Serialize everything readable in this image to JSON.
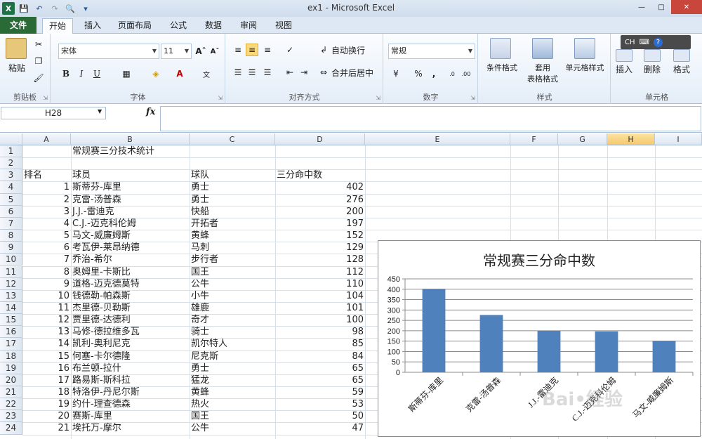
{
  "window": {
    "title": "ex1 - Microsoft Excel"
  },
  "tabs": [
    {
      "label": "文件"
    },
    {
      "label": "开始"
    },
    {
      "label": "插入"
    },
    {
      "label": "页面布局"
    },
    {
      "label": "公式"
    },
    {
      "label": "数据"
    },
    {
      "label": "审阅"
    },
    {
      "label": "视图"
    }
  ],
  "ribbon": {
    "clipboard": {
      "label": "剪贴板",
      "paste": "粘贴"
    },
    "font": {
      "label": "字体",
      "name": "宋体",
      "size": "11",
      "bold": "B",
      "italic": "I",
      "underline": "U"
    },
    "alignment": {
      "label": "对齐方式",
      "wrap": "自动换行",
      "merge": "合并后居中"
    },
    "number": {
      "label": "数字",
      "format": "常规",
      "percent": "%",
      "comma": ","
    },
    "styles": {
      "label": "样式",
      "conditional": "条件格式",
      "table_line1": "套用",
      "table_line2": "表格格式",
      "cell_styles": "单元格样式"
    },
    "cells": {
      "label": "单元格",
      "insert": "插入",
      "delete": "删除",
      "format": "格式"
    }
  },
  "ime": {
    "label": "CH"
  },
  "formula_bar": {
    "name_box": "H28",
    "fx": "fx",
    "value": ""
  },
  "columns": [
    {
      "label": "A"
    },
    {
      "label": "B"
    },
    {
      "label": "C"
    },
    {
      "label": "D"
    },
    {
      "label": "E"
    },
    {
      "label": "F"
    },
    {
      "label": "G"
    },
    {
      "label": "H"
    },
    {
      "label": "I"
    }
  ],
  "row_numbers": [
    "1",
    "2",
    "3",
    "4",
    "5",
    "6",
    "7",
    "8",
    "9",
    "10",
    "11",
    "12",
    "13",
    "14",
    "15",
    "16",
    "17",
    "18",
    "19",
    "20",
    "21",
    "22",
    "23",
    "24"
  ],
  "sheet": {
    "title": "常规赛三分技术统计",
    "headers": {
      "rank": "排名",
      "player": "球员",
      "team": "球队",
      "threes": "三分命中数"
    },
    "rows": [
      {
        "rank": "1",
        "player": "斯蒂芬-库里",
        "team": "勇士",
        "threes": "402"
      },
      {
        "rank": "2",
        "player": "克雷-汤普森",
        "team": "勇士",
        "threes": "276"
      },
      {
        "rank": "3",
        "player": "J.J.-雷迪克",
        "team": "快船",
        "threes": "200"
      },
      {
        "rank": "4",
        "player": "C.J.-迈克科伦姆",
        "team": "开拓者",
        "threes": "197"
      },
      {
        "rank": "5",
        "player": "马文-威廉姆斯",
        "team": "黄蜂",
        "threes": "152"
      },
      {
        "rank": "6",
        "player": "考瓦伊-莱昂纳德",
        "team": "马刺",
        "threes": "129"
      },
      {
        "rank": "7",
        "player": "乔治-希尔",
        "team": "步行者",
        "threes": "128"
      },
      {
        "rank": "8",
        "player": "奥姆里-卡斯比",
        "team": "国王",
        "threes": "112"
      },
      {
        "rank": "9",
        "player": "道格-迈克德莫特",
        "team": "公牛",
        "threes": "110"
      },
      {
        "rank": "10",
        "player": "钱德勒-帕森斯",
        "team": "小牛",
        "threes": "104"
      },
      {
        "rank": "11",
        "player": "杰里德-贝勒斯",
        "team": "雄鹿",
        "threes": "101"
      },
      {
        "rank": "12",
        "player": "贾里德-达德利",
        "team": "奇才",
        "threes": "100"
      },
      {
        "rank": "13",
        "player": "马修-德拉维多瓦",
        "team": "骑士",
        "threes": "98"
      },
      {
        "rank": "14",
        "player": "凯利-奥利尼克",
        "team": "凯尔特人",
        "threes": "85"
      },
      {
        "rank": "15",
        "player": "何塞-卡尔德隆",
        "team": "尼克斯",
        "threes": "84"
      },
      {
        "rank": "16",
        "player": "布兰顿-拉什",
        "team": "勇士",
        "threes": "65"
      },
      {
        "rank": "17",
        "player": "路易斯-斯科拉",
        "team": "猛龙",
        "threes": "65"
      },
      {
        "rank": "18",
        "player": "特洛伊-丹尼尔斯",
        "team": "黄蜂",
        "threes": "59"
      },
      {
        "rank": "19",
        "player": "约什-理查德森",
        "team": "热火",
        "threes": "53"
      },
      {
        "rank": "20",
        "player": "赛斯-库里",
        "team": "国王",
        "threes": "50"
      },
      {
        "rank": "21",
        "player": "埃托万-摩尔",
        "team": "公牛",
        "threes": "47"
      }
    ]
  },
  "chart_data": {
    "type": "bar",
    "title": "常规赛三分命中数",
    "categories": [
      "斯蒂芬-库里",
      "克雷-汤普森",
      "J.J.-雷迪克",
      "C.J.-迈克科伦姆",
      "马文-威廉姆斯"
    ],
    "values": [
      402,
      276,
      200,
      197,
      152
    ],
    "ylim": [
      0,
      450
    ],
    "yticks": [
      "0",
      "50",
      "100",
      "150",
      "200",
      "250",
      "300",
      "350",
      "400",
      "450"
    ],
    "grid": true,
    "bar_color": "#4f81bd"
  },
  "colors": {
    "file_tab": "#2a6a36",
    "selected_col": "#f5c86b",
    "bar": "#4f81bd"
  }
}
